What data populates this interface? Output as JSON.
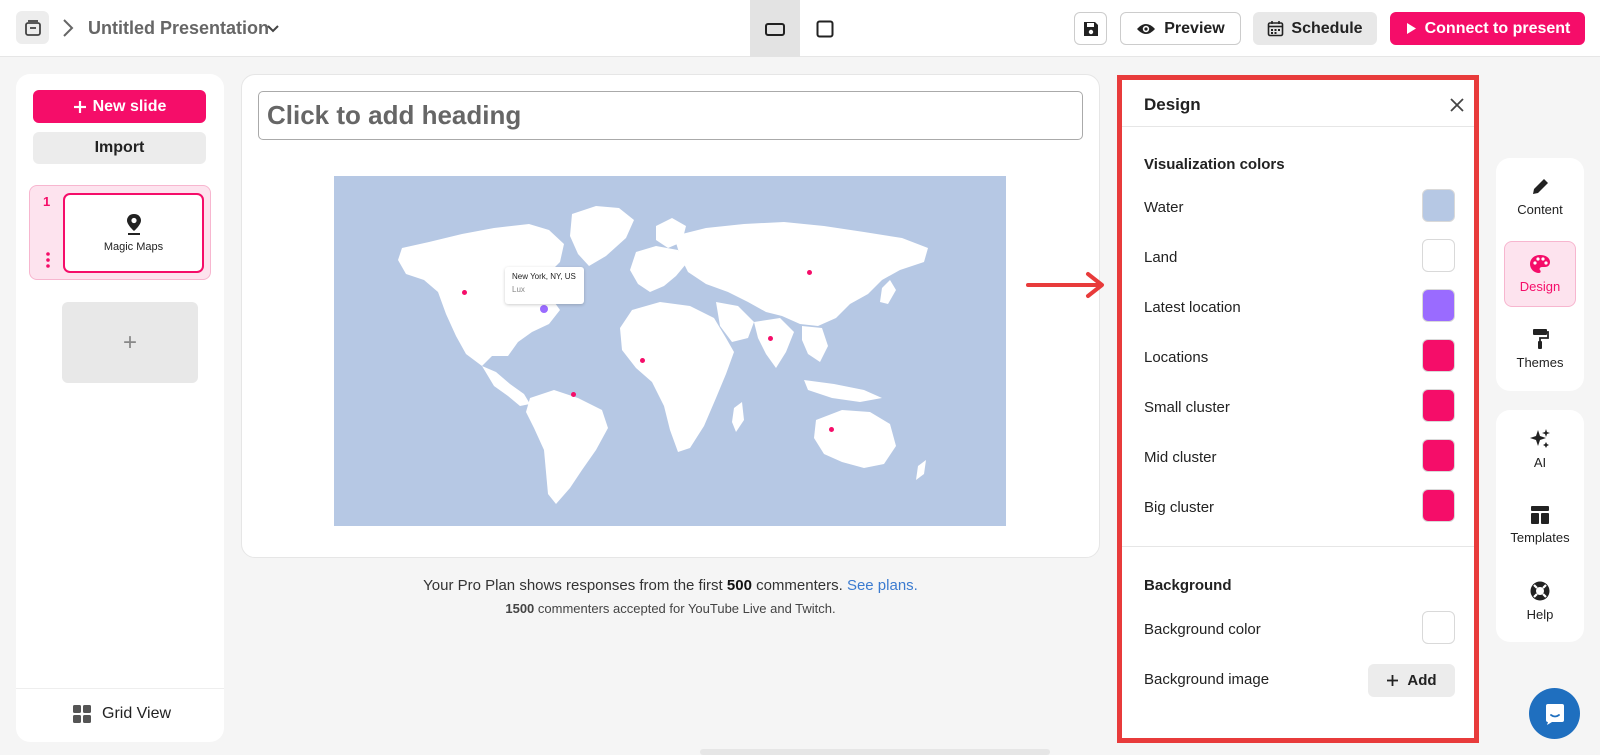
{
  "header": {
    "title": "Untitled Presentation",
    "preview_label": "Preview",
    "schedule_label": "Schedule",
    "present_label": "Connect to present"
  },
  "sidebar": {
    "new_slide_label": "New slide",
    "import_label": "Import",
    "slides": [
      {
        "number": "1",
        "label": "Magic Maps"
      }
    ],
    "add_symbol": "+",
    "grid_view_label": "Grid View"
  },
  "canvas": {
    "heading_placeholder": "Click to add heading",
    "map_tooltip": {
      "city": "New York, NY, US",
      "user": "Lux"
    }
  },
  "plan": {
    "text_before": "Your Pro Plan shows responses from the first ",
    "count": "500",
    "text_after": " commenters.",
    "link": "See plans.",
    "line2_count": "1500",
    "line2_text": " commenters accepted for YouTube Live and Twitch."
  },
  "design_panel": {
    "title": "Design",
    "visualization_title": "Visualization colors",
    "colors": [
      {
        "label": "Water",
        "color": "#b6c8e4"
      },
      {
        "label": "Land",
        "color": "#ffffff"
      },
      {
        "label": "Latest location",
        "color": "#9a6bff"
      },
      {
        "label": "Locations",
        "color": "#f50d69"
      },
      {
        "label": "Small cluster",
        "color": "#f50d69"
      },
      {
        "label": "Mid cluster",
        "color": "#f50d69"
      },
      {
        "label": "Big cluster",
        "color": "#f50d69"
      }
    ],
    "background_title": "Background",
    "background_color_label": "Background color",
    "background_color": "#ffffff",
    "background_image_label": "Background image",
    "add_label": "Add"
  },
  "rail": {
    "content_label": "Content",
    "design_label": "Design",
    "themes_label": "Themes",
    "ai_label": "AI",
    "templates_label": "Templates",
    "help_label": "Help"
  },
  "theme": {
    "accent": "#f50d69",
    "highlight": "#e83b3b"
  }
}
